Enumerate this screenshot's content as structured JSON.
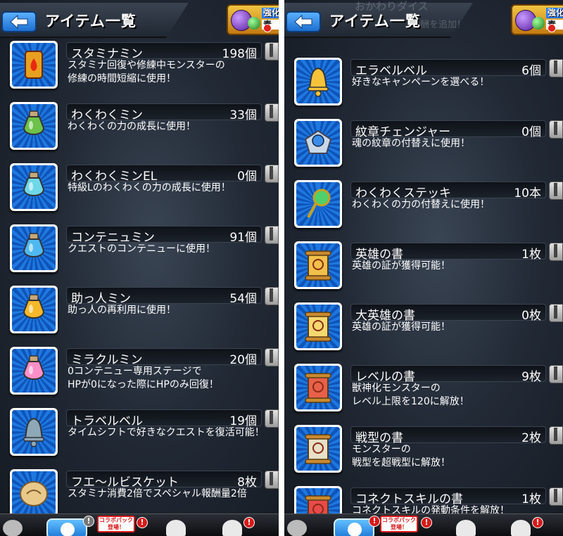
{
  "header": {
    "title": "アイテム一覧",
    "badge_line1": "強化",
    "badge_line2": "素",
    "right_ghost_line1": "おかわりダイス",
    "right_ghost_line2": "報酬を追加！"
  },
  "left_items": [
    {
      "name": "スタミナミン",
      "count": "198個",
      "desc": "スタミナ回復や修練中モンスターの\n修練の時間短縮に使用！",
      "icon": "stamina-can-icon",
      "color": "#e8a020"
    },
    {
      "name": "わくわくミン",
      "count": "33個",
      "desc": "わくわくの力の成長に使用！",
      "icon": "sprout-bottle-icon",
      "color": "#6cc24a"
    },
    {
      "name": "わくわくミンEL",
      "count": "0個",
      "desc": "特級Lのわくわくの力の成長に使用！",
      "icon": "sprout-bottle-el-icon",
      "color": "#6fd8e8"
    },
    {
      "name": "コンテニュミン",
      "count": "91個",
      "desc": "クエストのコンテニューに使用！",
      "icon": "continue-jar-icon",
      "color": "#4fb8f0"
    },
    {
      "name": "助っ人ミン",
      "count": "54個",
      "desc": "助っ人の再利用に使用！",
      "icon": "helper-bottle-icon",
      "color": "#f5b82a"
    },
    {
      "name": "ミラクルミン",
      "count": "20個",
      "desc": "0コンテニュー専用ステージで\nHPが0になった際にHPのみ回復！",
      "icon": "heart-flask-icon",
      "color": "#ff8fc8"
    },
    {
      "name": "トラベルベル",
      "count": "19個",
      "desc": "タイムシフトで好きなクエストを復活可能！",
      "icon": "travel-bell-icon",
      "color": "#8ea8b8"
    },
    {
      "name": "フエ〜ルビスケット",
      "count": "8枚",
      "desc": "スタミナ消費2倍でスペシャル報酬量2倍",
      "icon": "biscuit-icon",
      "color": "#e8c98a"
    }
  ],
  "right_items": [
    {
      "name": "エラベルベル",
      "count": "6個",
      "desc": "好きなキャンペーンを選べる！",
      "icon": "gold-bell-icon",
      "color": "#f5c23a"
    },
    {
      "name": "紋章チェンジャー",
      "count": "0個",
      "desc": "魂の紋章の付替えに使用！",
      "icon": "emblem-changer-icon",
      "color": "#c8d8e8"
    },
    {
      "name": "わくわくステッキ",
      "count": "10本",
      "desc": "わくわくの力の付替えに使用！",
      "icon": "magic-stick-icon",
      "color": "#4fd06a"
    },
    {
      "name": "英雄の書",
      "count": "1枚",
      "desc": "英雄の証が獲得可能！",
      "icon": "hero-scroll-icon",
      "color": "#f0c04a"
    },
    {
      "name": "大英雄の書",
      "count": "0枚",
      "desc": "英雄の証が獲得可能！",
      "icon": "great-hero-scroll-icon",
      "color": "#f5d870"
    },
    {
      "name": "レベルの書",
      "count": "9枚",
      "desc": "獣神化モンスターの\nレベル上限を120に解放！",
      "icon": "level-scroll-icon",
      "color": "#e8604a"
    },
    {
      "name": "戦型の書",
      "count": "2枚",
      "desc": "モンスターの\n戦型を超戦型に解放！",
      "icon": "battle-type-scroll-icon",
      "color": "#e8e0c8"
    },
    {
      "name": "コネクトスキルの書",
      "count": "1枚",
      "desc": "コネクトスキルの発動条件を解放！",
      "icon": "connect-skill-scroll-icon",
      "color": "#e84a4a"
    }
  ],
  "footer": {
    "collab_label": "コラボパック登場！",
    "alert_mark": "!"
  }
}
